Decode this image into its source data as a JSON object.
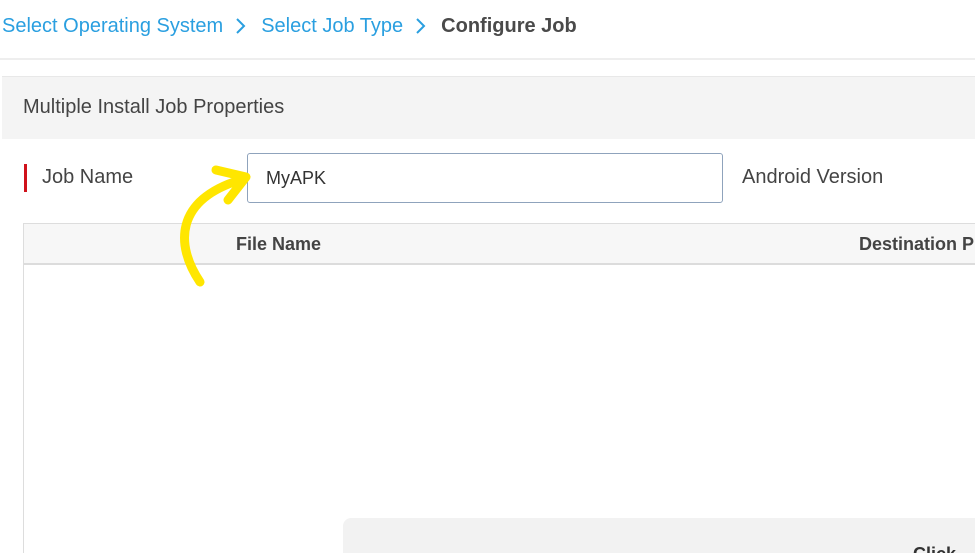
{
  "breadcrumb": {
    "items": [
      {
        "label": "Select Operating System"
      },
      {
        "label": "Select Job Type"
      },
      {
        "label": "Configure Job"
      }
    ],
    "separator_icon": "chevron-right-icon"
  },
  "panel": {
    "title": "Multiple Install Job Properties"
  },
  "form": {
    "job_name_label": "Job Name",
    "job_name_value": "MyAPK",
    "android_version_label": "Android Version"
  },
  "table": {
    "columns": [
      "File Name",
      "Destination P"
    ],
    "rows": []
  },
  "upload_zone": {
    "label": "Click"
  },
  "annotation": {
    "icon": "curved-arrow-icon",
    "color": "#ffe600"
  },
  "colors": {
    "link": "#2a9fe0",
    "required": "#d0121b",
    "input_border": "#8fa3bc"
  }
}
